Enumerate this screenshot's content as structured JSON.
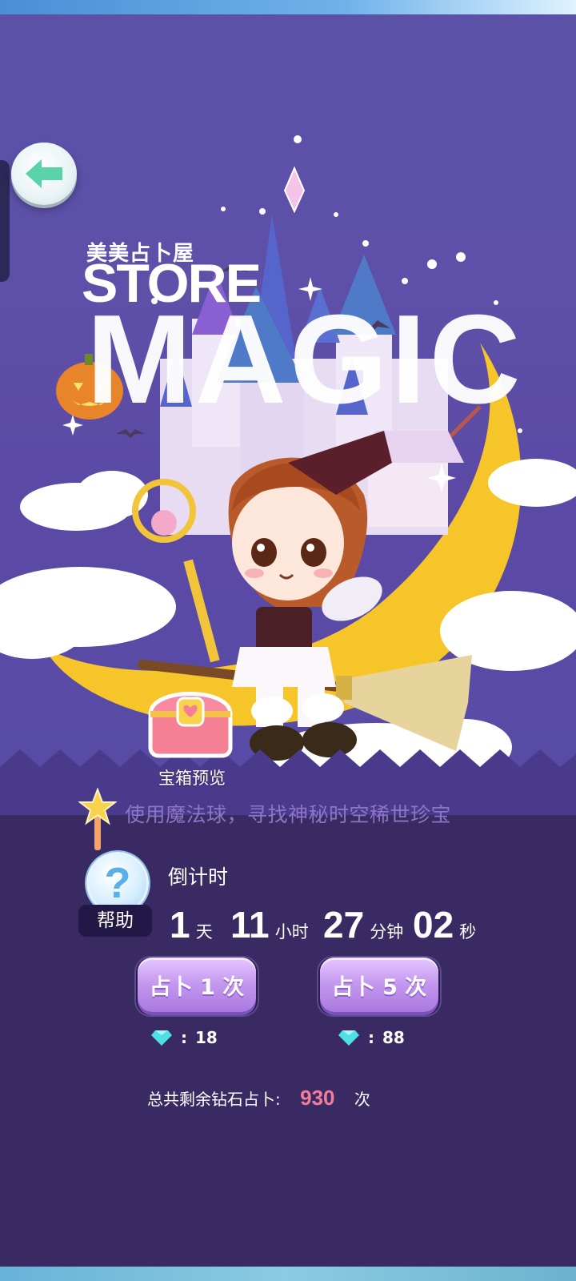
{
  "app": {
    "brand_cn": "美美占卜屋",
    "brand_store": "STORE",
    "brand_magic": "MAGIC"
  },
  "icons": {
    "back": "back-arrow-icon",
    "help": "question-mark-icon",
    "chest": "treasure-chest-icon",
    "diamond": "diamond-icon",
    "star_wand": "star-wand-icon"
  },
  "scene": {
    "chest_label": "宝箱预览",
    "hint": "使用魔法球，寻找神秘时空稀世珍宝"
  },
  "help": {
    "symbol": "?",
    "label": "帮助"
  },
  "countdown": {
    "title": "倒计时",
    "days": "1",
    "days_unit": "天",
    "hours": "11",
    "hours_unit": "小时",
    "minutes": "27",
    "minutes_unit": "分钟",
    "seconds": "02",
    "seconds_unit": "秒"
  },
  "actions": {
    "draw1_label": "占卜 1 次",
    "draw1_sep": ":",
    "draw1_cost": "18",
    "draw5_label": "占卜 5 次",
    "draw5_sep": ":",
    "draw5_cost": "88"
  },
  "total": {
    "label": "总共剩余钻石占卜:",
    "count": "930",
    "unit": "次"
  },
  "colors": {
    "panel_bg": "#3a2a63",
    "scene_bg": "#5a4aa5",
    "button": "#c59af0",
    "accent_count": "#f27c99",
    "moon": "#f6c52a",
    "back_arrow": "#5ad3a8"
  }
}
